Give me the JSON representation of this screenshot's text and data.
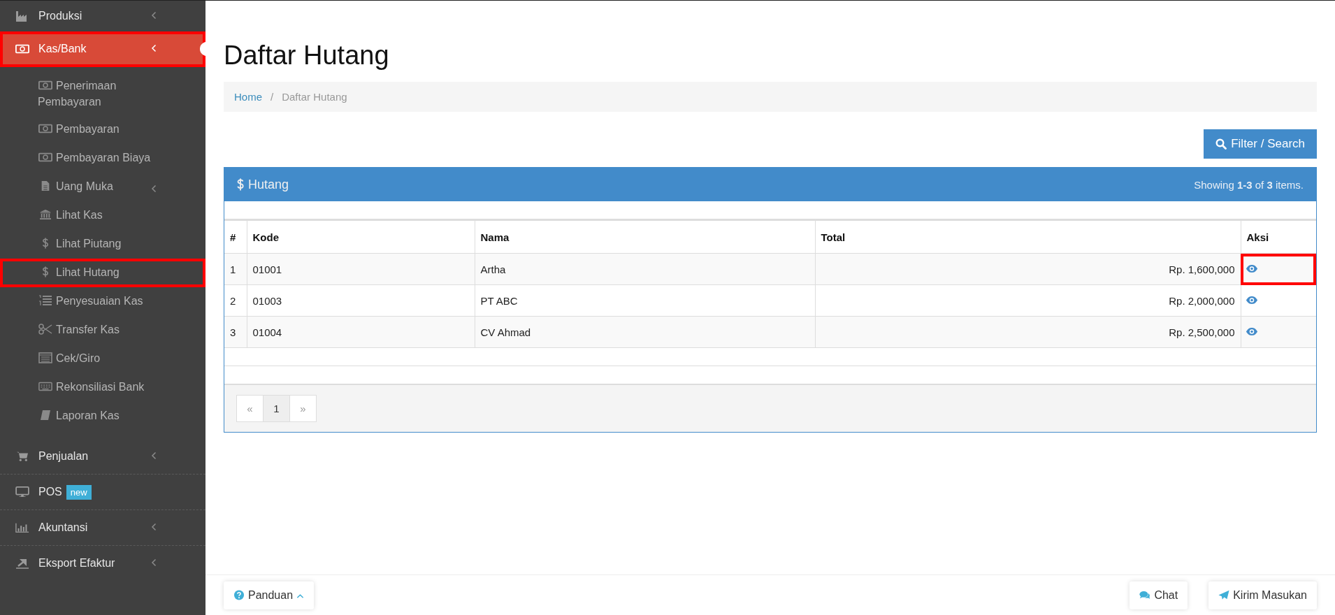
{
  "sidebar": {
    "items": [
      {
        "label": "Produksi",
        "selected": false,
        "submenu": true,
        "highlighted": false
      },
      {
        "label": "Kas/Bank",
        "selected": true,
        "submenu": true,
        "highlighted": true,
        "children": [
          {
            "label": "Penerimaan Pembayaran",
            "submenu": false,
            "highlighted": false
          },
          {
            "label": "Pembayaran",
            "submenu": false,
            "highlighted": false
          },
          {
            "label": "Pembayaran Biaya",
            "submenu": false,
            "highlighted": false
          },
          {
            "label": "Uang Muka",
            "submenu": true,
            "highlighted": false
          },
          {
            "label": "Lihat Kas",
            "submenu": false,
            "highlighted": false
          },
          {
            "label": "Lihat Piutang",
            "submenu": false,
            "highlighted": false
          },
          {
            "label": "Lihat Hutang",
            "submenu": false,
            "highlighted": true
          },
          {
            "label": "Penyesuaian Kas",
            "submenu": false,
            "highlighted": false
          },
          {
            "label": "Transfer Kas",
            "submenu": false,
            "highlighted": false
          },
          {
            "label": "Cek/Giro",
            "submenu": false,
            "highlighted": false
          },
          {
            "label": "Rekonsiliasi Bank",
            "submenu": false,
            "highlighted": false
          },
          {
            "label": "Laporan Kas",
            "submenu": false,
            "highlighted": false
          }
        ]
      },
      {
        "label": "Penjualan",
        "selected": false,
        "submenu": true,
        "highlighted": false
      },
      {
        "label": "POS",
        "badge": "new",
        "selected": false,
        "submenu": false,
        "highlighted": false
      },
      {
        "label": "Akuntansi",
        "selected": false,
        "submenu": true,
        "highlighted": false
      },
      {
        "label": "Eksport Efaktur",
        "selected": false,
        "submenu": true,
        "highlighted": false
      }
    ]
  },
  "page": {
    "title": "Daftar Hutang",
    "breadcrumb": [
      {
        "label": "Home",
        "kind": "link"
      },
      {
        "label": "/",
        "kind": "separator"
      },
      {
        "label": "Daftar Hutang",
        "kind": "current"
      }
    ],
    "filter_button": "Filter / Search"
  },
  "panel": {
    "title": "Hutang",
    "summary": "Showing **1-3** of **3** items.",
    "table": {
      "columns": [
        "#",
        "Kode",
        "Nama",
        "Total",
        "Aksi"
      ],
      "rows": [
        {
          "cells": [
            "1",
            "01001",
            "Artha",
            "Rp. 1,600,000"
          ],
          "highlighted": true
        },
        {
          "cells": [
            "2",
            "01003",
            "PT ABC",
            "Rp. 2,000,000"
          ],
          "highlighted": false
        },
        {
          "cells": [
            "3",
            "01004",
            "CV Ahmad",
            "Rp. 2,500,000"
          ],
          "highlighted": false
        }
      ]
    },
    "pagination": [
      {
        "label": "«",
        "selected": false,
        "disabled": true
      },
      {
        "label": "1",
        "selected": true,
        "disabled": false
      },
      {
        "label": "»",
        "selected": false,
        "disabled": true
      }
    ]
  },
  "footer": {
    "buttons": [
      {
        "label": "Panduan"
      },
      {
        "label": "Chat"
      },
      {
        "label": "Kirim Masukan"
      }
    ]
  }
}
